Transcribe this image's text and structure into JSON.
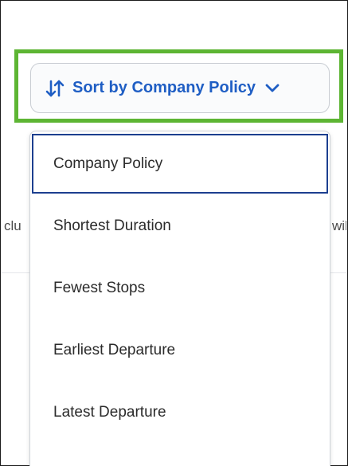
{
  "sort_button": {
    "label": "Sort by Company Policy",
    "icon": "sort-arrows-icon",
    "chevron": "chevron-down-icon"
  },
  "menu": {
    "items": [
      {
        "label": "Company Policy",
        "selected": true
      },
      {
        "label": "Shortest Duration",
        "selected": false
      },
      {
        "label": "Fewest Stops",
        "selected": false
      },
      {
        "label": "Earliest Departure",
        "selected": false
      },
      {
        "label": "Latest Departure",
        "selected": false
      }
    ]
  },
  "background": {
    "left_fragment": "clu",
    "right_fragment": "wil"
  },
  "colors": {
    "accent": "#1f5ec4",
    "highlight": "#5db533",
    "selected_border": "#1c3f8f"
  }
}
